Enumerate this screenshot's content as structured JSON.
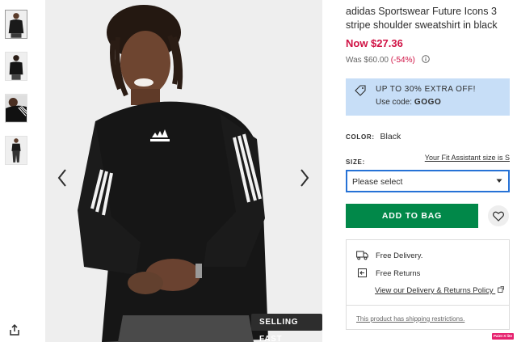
{
  "gallery": {
    "thumbnails": [
      "front-view",
      "back-view",
      "detail-view",
      "full-view"
    ],
    "selected_index": 0,
    "badge": "SELLING FAST",
    "icons": {
      "prev": "chevron-left-icon",
      "next": "chevron-right-icon",
      "share": "share-icon"
    }
  },
  "product": {
    "title": "adidas Sportswear Future Icons 3 stripe shoulder sweatshirt in black",
    "price_now": "Now $27.36",
    "price_was": "Was $60.00",
    "discount": "(-54%)"
  },
  "promo": {
    "headline": "UP TO 30% EXTRA OFF!",
    "code_prefix": "Use code:",
    "code": "GOGO",
    "icon": "tag-icon"
  },
  "options": {
    "color_label": "COLOR:",
    "color_value": "Black",
    "size_label": "SIZE:",
    "fit_link": "Your Fit Assistant size is S",
    "size_placeholder": "Please select"
  },
  "actions": {
    "add_to_bag": "ADD TO BAG",
    "save_icon": "heart-icon"
  },
  "delivery": {
    "free_delivery": "Free Delivery.",
    "free_returns": "Free Returns",
    "policy_link": "View our Delivery & Returns Policy",
    "shipping_restrictions": "This product has shipping restrictions."
  },
  "overlay": {
    "badge": "Paint X lite"
  },
  "colors": {
    "price_red": "#d01345",
    "promo_blue": "#c7def7",
    "bag_green": "#018849",
    "select_border": "#2672d6",
    "text": "#2d2d2d"
  }
}
